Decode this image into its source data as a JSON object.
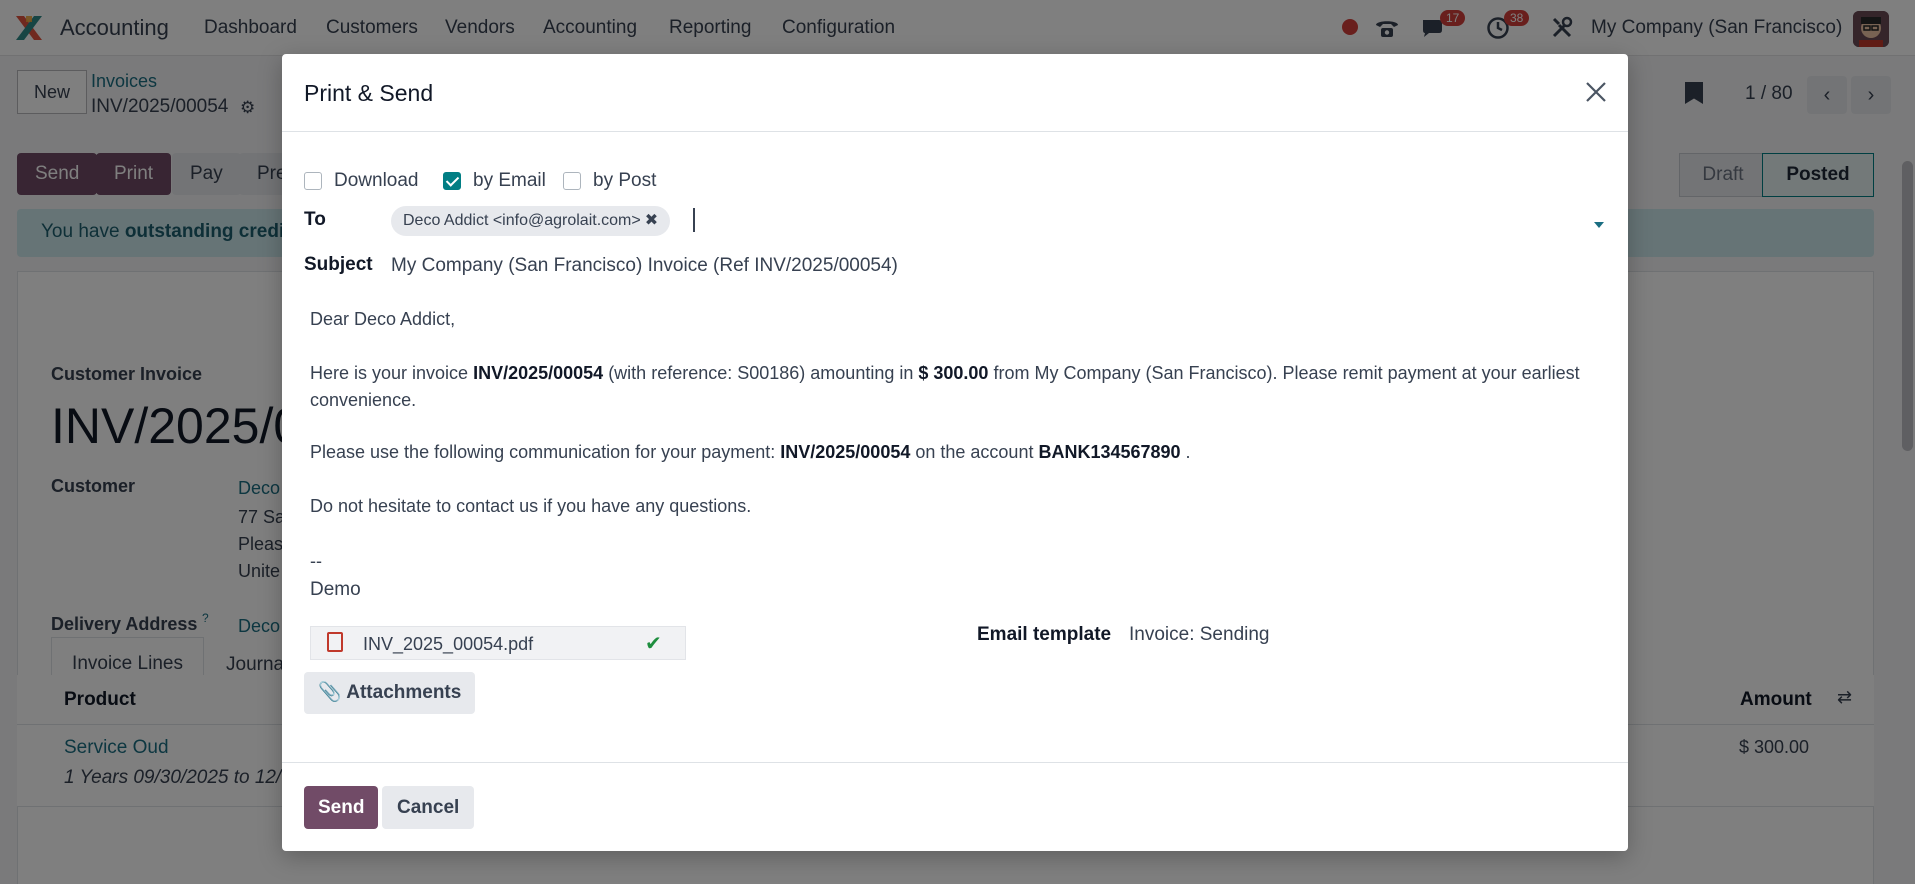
{
  "app": {
    "name": "Accounting"
  },
  "nav": [
    "Dashboard",
    "Customers",
    "Vendors",
    "Accounting",
    "Reporting",
    "Configuration"
  ],
  "systray": {
    "messages_count": "17",
    "activities_count": "38",
    "company": "My Company (San Francisco)"
  },
  "control_panel": {
    "new_label": "New",
    "breadcrumb_parent": "Invoices",
    "breadcrumb_current": "INV/2025/00054",
    "pager": "1 / 80"
  },
  "actions": {
    "send": "Send",
    "print": "Print",
    "pay": "Pay",
    "preview": "Pre"
  },
  "status": {
    "draft": "Draft",
    "posted": "Posted"
  },
  "alert": {
    "text_plain": "You have ",
    "text_bold": "outstanding credit"
  },
  "form": {
    "type_label": "Customer Invoice",
    "number": "INV/2025/0",
    "customer_label": "Customer",
    "customer_value": "Deco",
    "address_lines": [
      "77 Sa",
      "Pleas",
      "Unite"
    ],
    "delivery_label": "Delivery Address",
    "delivery_help": "?",
    "delivery_value": "Deco",
    "tabs": [
      "Invoice Lines",
      "Journa"
    ],
    "columns": {
      "product": "Product",
      "amount": "Amount"
    },
    "line": {
      "product": "Service Oud",
      "description": "1 Years 09/30/2025 to 12/",
      "amount": "$ 300.00"
    }
  },
  "modal": {
    "title": "Print & Send",
    "options": [
      {
        "label": "Download",
        "checked": false
      },
      {
        "label": "by Email",
        "checked": true
      },
      {
        "label": "by Post",
        "checked": false
      }
    ],
    "to_label": "To",
    "recipient": "Deco Addict <info@agrolait.com>",
    "subject_label": "Subject",
    "subject": "My Company (San Francisco) Invoice (Ref INV/2025/00054)",
    "body": {
      "greeting": "Dear Deco Addict,",
      "p1_a": "Here is your invoice ",
      "p1_invoice": "INV/2025/00054",
      "p1_b": " (with reference: S00186) amounting in ",
      "p1_amount": "$ 300.00",
      "p1_c": " from My Company (San Francisco). Please remit payment at your earliest convenience.",
      "p2_a": "Please use the following communication for your payment: ",
      "p2_ref": "INV/2025/00054",
      "p2_b": " on the account ",
      "p2_account": "BANK134567890",
      "p2_c": " .",
      "p3": "Do not hesitate to contact us if you have any questions.",
      "sig_dash": "--",
      "sig_name": "Demo"
    },
    "attachment_name": "INV_2025_00054.pdf",
    "attachments_button": "Attachments",
    "template_label": "Email template",
    "template_value": "Invoice: Sending",
    "send_button": "Send",
    "cancel_button": "Cancel"
  },
  "colors": {
    "primary": "#714b67",
    "teal": "#017e84",
    "link": "#1a6e82",
    "badge": "#d23f3a"
  }
}
